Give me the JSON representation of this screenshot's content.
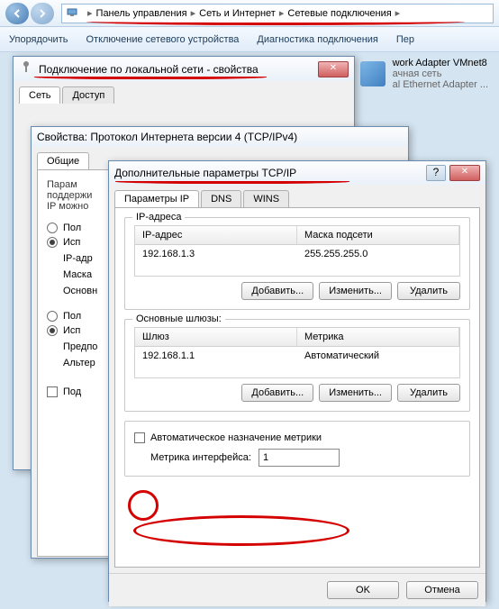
{
  "breadcrumb": {
    "items": [
      "Панель управления",
      "Сеть и Интернет",
      "Сетевые подключения"
    ]
  },
  "toolbar": {
    "items": [
      "Упорядочить",
      "Отключение сетевого устройства",
      "Диагностика подключения",
      "Пер"
    ]
  },
  "networkItem": {
    "name": "work Adapter VMnet8",
    "line2": "ачная сеть",
    "line3": "al Ethernet Adapter ..."
  },
  "win1": {
    "title": "Подключение по локальной сети - свойства",
    "tabs": [
      "Сеть",
      "Доступ"
    ]
  },
  "win2": {
    "title": "Свойства: Протокол Интернета версии 4 (TCP/IPv4)",
    "tabs": [
      "Общие"
    ],
    "text1": "Парам",
    "text2": "поддержи",
    "text3": "IP можно",
    "radio_auto": "Пол",
    "radio_use": "Исп",
    "label_ip": "IP-адр",
    "label_mask": "Маска",
    "label_gw": "Основн",
    "radio_auto2": "Пол",
    "radio_use2": "Исп",
    "label_pref": "Предпо",
    "label_alt": "Альтер",
    "check_confirm": "Под"
  },
  "win3": {
    "title": "Дополнительные параметры TCP/IP",
    "tabs": [
      "Параметры IP",
      "DNS",
      "WINS"
    ],
    "group_ip": "IP-адреса",
    "th_ip": "IP-адрес",
    "th_mask": "Маска подсети",
    "row_ip": "192.168.1.3",
    "row_mask": "255.255.255.0",
    "btn_add": "Добавить...",
    "btn_edit": "Изменить...",
    "btn_del": "Удалить",
    "group_gw": "Основные шлюзы:",
    "th_gw": "Шлюз",
    "th_metric": "Метрика",
    "row_gw": "192.168.1.1",
    "row_metric": "Автоматический",
    "check_auto_metric": "Автоматическое назначение метрики",
    "label_if_metric": "Метрика интерфейса:",
    "value_if_metric": "1",
    "btn_ok": "OK",
    "btn_cancel": "Отмена"
  }
}
